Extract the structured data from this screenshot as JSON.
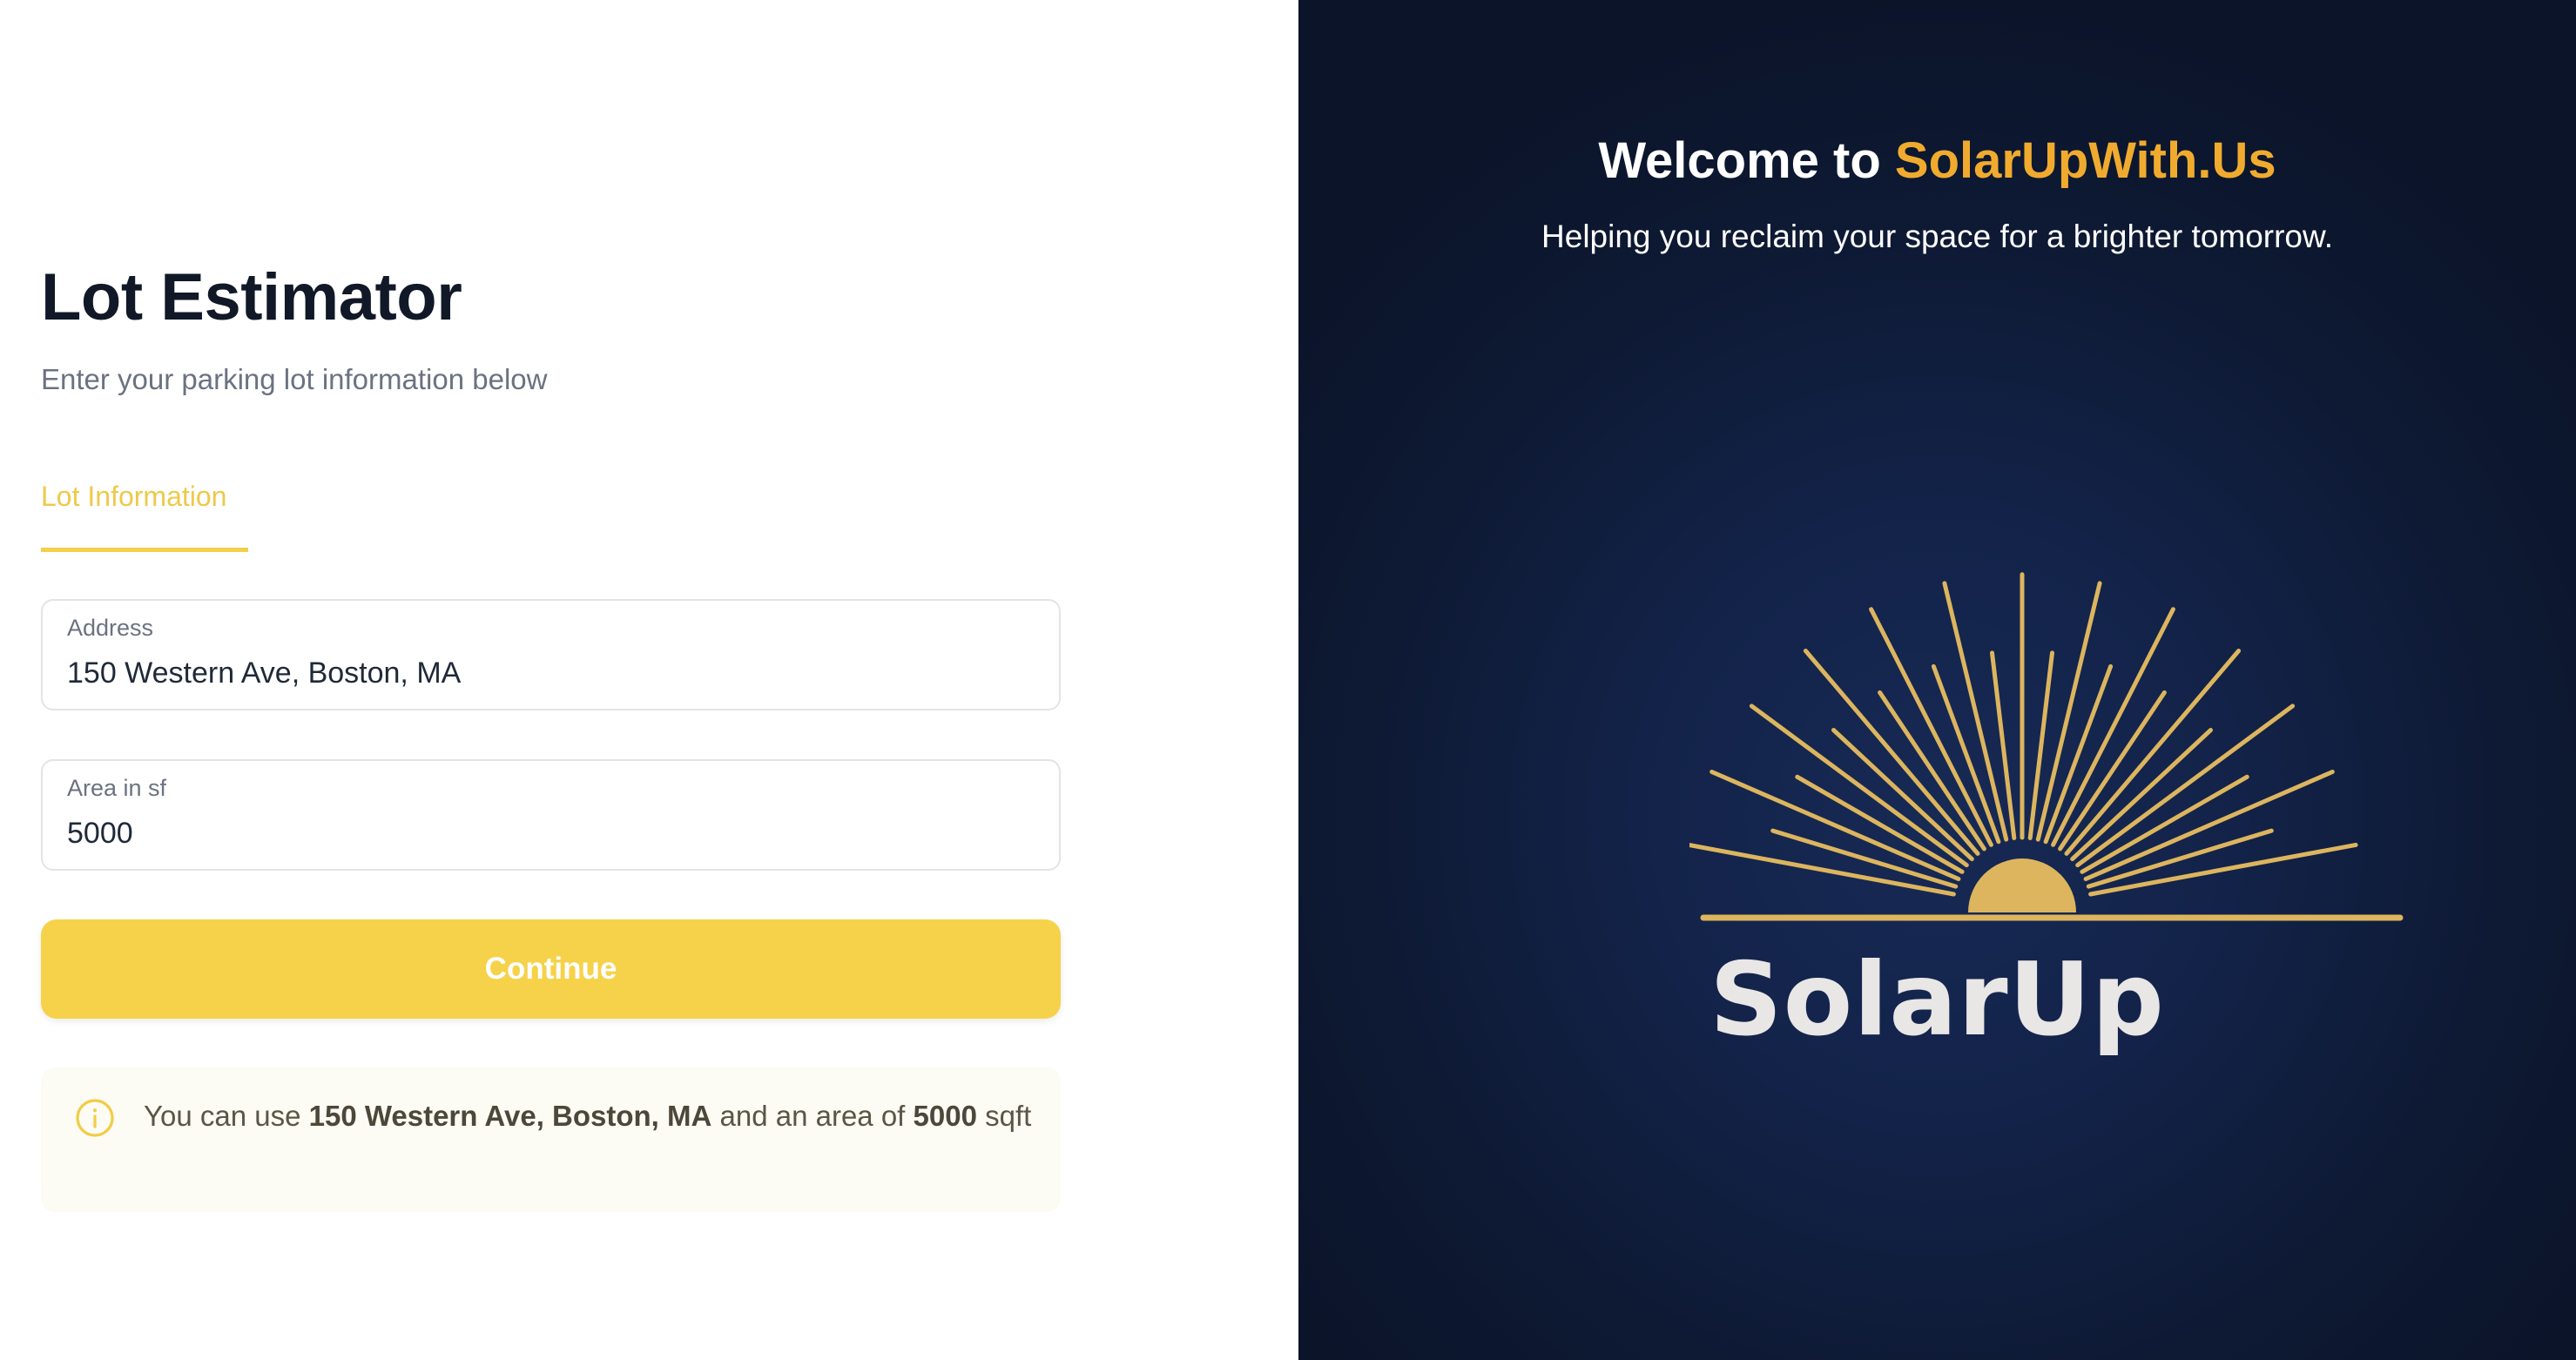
{
  "form": {
    "title": "Lot Estimator",
    "subtitle": "Enter your parking lot information below",
    "tab_label": "Lot Information",
    "address": {
      "label": "Address",
      "value": "150 Western Ave, Boston, MA"
    },
    "area": {
      "label": "Area in sf",
      "value": "5000"
    },
    "continue_label": "Continue",
    "hint": {
      "prefix": "You can use ",
      "address": "150 Western Ave, Boston, MA",
      "middle": " and an area of ",
      "area": "5000",
      "suffix": " sqft"
    }
  },
  "hero": {
    "welcome_prefix": "Welcome to ",
    "brand_name": "SolarUpWith.Us",
    "tagline": "Helping you reclaim your space for a brighter tomorrow.",
    "logo_text": "SolarUp"
  },
  "icons": {
    "hint": "info-circle-icon",
    "logo": "sunrise-rays-icon"
  },
  "colors": {
    "accent": "#f6d24b",
    "brand": "#f0ab2f",
    "panel_bg": "#0e1a35",
    "logo_gold": "#dcb55e"
  }
}
